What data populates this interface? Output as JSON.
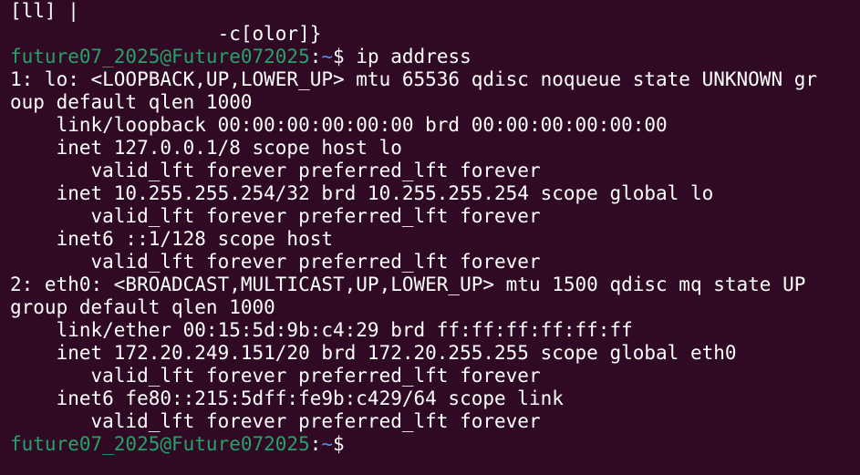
{
  "terminal": {
    "lines": [
      "[ll] |",
      "                  -c[olor]}"
    ],
    "prompt1": {
      "user_host": "future07_2025@Future072025",
      "colon": ":",
      "path": "~",
      "dollar": "$ ",
      "command": "ip address"
    },
    "output": [
      "1: lo: <LOOPBACK,UP,LOWER_UP> mtu 65536 qdisc noqueue state UNKNOWN gr",
      "oup default qlen 1000",
      "    link/loopback 00:00:00:00:00:00 brd 00:00:00:00:00:00",
      "    inet 127.0.0.1/8 scope host lo",
      "       valid_lft forever preferred_lft forever",
      "    inet 10.255.255.254/32 brd 10.255.255.254 scope global lo",
      "       valid_lft forever preferred_lft forever",
      "    inet6 ::1/128 scope host",
      "       valid_lft forever preferred_lft forever",
      "2: eth0: <BROADCAST,MULTICAST,UP,LOWER_UP> mtu 1500 qdisc mq state UP",
      "group default qlen 1000",
      "    link/ether 00:15:5d:9b:c4:29 brd ff:ff:ff:ff:ff:ff",
      "    inet 172.20.249.151/20 brd 172.20.255.255 scope global eth0",
      "       valid_lft forever preferred_lft forever",
      "    inet6 fe80::215:5dff:fe9b:c429/64 scope link",
      "       valid_lft forever preferred_lft forever"
    ],
    "prompt2": {
      "user_host": "future07_2025@Future072025",
      "colon": ":",
      "path": "~",
      "dollar": "$"
    },
    "colors": {
      "background": "#300a24",
      "text": "#ffffff",
      "user_host": "#26a269",
      "path": "#4c8ee3"
    }
  }
}
